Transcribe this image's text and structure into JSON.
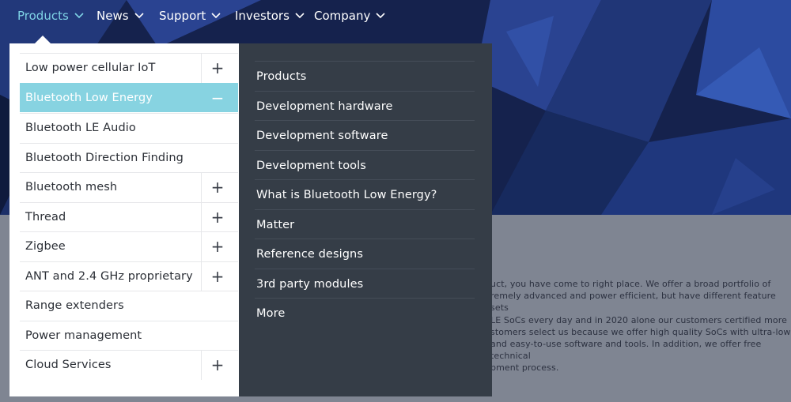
{
  "nav": {
    "items": [
      {
        "label": "Products",
        "active": true
      },
      {
        "label": "News",
        "active": false
      },
      {
        "label": "Support",
        "active": false
      },
      {
        "label": "Investors",
        "active": false
      },
      {
        "label": "Company",
        "active": false
      }
    ]
  },
  "menu": {
    "categories": [
      {
        "label": "Low power cellular IoT",
        "toggle": "+"
      },
      {
        "label": "Bluetooth Low Energy",
        "toggle": "−"
      },
      {
        "label": "Bluetooth LE Audio",
        "toggle": ""
      },
      {
        "label": "Bluetooth Direction Finding",
        "toggle": ""
      },
      {
        "label": "Bluetooth mesh",
        "toggle": "+"
      },
      {
        "label": "Thread",
        "toggle": "+"
      },
      {
        "label": "Zigbee",
        "toggle": "+"
      },
      {
        "label": "ANT and 2.4 GHz proprietary",
        "toggle": "+"
      },
      {
        "label": "Range extenders",
        "toggle": ""
      },
      {
        "label": "Power management",
        "toggle": ""
      },
      {
        "label": "Cloud Services",
        "toggle": "+"
      }
    ],
    "submenu": [
      "Products",
      "Development hardware",
      "Development software",
      "Development tools",
      "What is Bluetooth Low Energy?",
      "Matter",
      "Reference designs",
      "3rd party modules",
      "More"
    ]
  },
  "background_text": "uct, you have come to right place. We offer a broad portfolio of\nremely advanced and power efficient, but have different feature sets\n LE SoCs every day and in 2020 alone our customers certified more\nstomers select us because we offer high quality SoCs with ultra-low\nand easy-to-use software and tools. In addition, we offer free technical\npment process.",
  "colors": {
    "accent": "#87d3e1",
    "nav_active": "#7fd3e6",
    "submenu_bg": "#353d47",
    "hero_bg": "#1a2a5c"
  }
}
